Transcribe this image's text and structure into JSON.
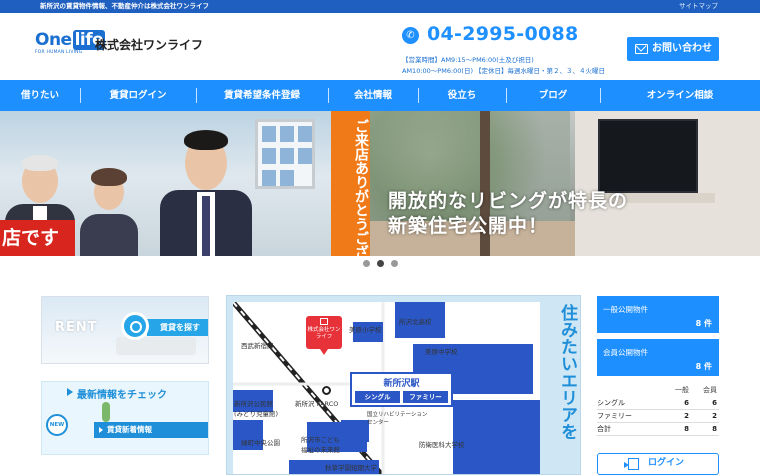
{
  "topbar": {
    "tagline": "新所沢の賃貸物件情報、不動産仲介は株式会社ワンライフ",
    "sitemap": "サイトマップ"
  },
  "header": {
    "logo_one": "One",
    "logo_life": "life",
    "logo_sub": "FOR HUMAN LIVING",
    "company": "株式会社ワンライフ",
    "phone": "04-2995-0088",
    "hours1": "【営業時間】AM9:15～PM6:00(土及び祝日)",
    "hours2": "AM10:00～PM6:00(日) 【定休日】毎週水曜日・第２、３、４火曜日",
    "contact": "お問い合わせ"
  },
  "nav": [
    {
      "label": "借りたい"
    },
    {
      "label": "賃貸ログイン"
    },
    {
      "label": "賃貸希望条件登録"
    },
    {
      "label": "会社情報"
    },
    {
      "label": "役立ち"
    },
    {
      "label": "ブログ"
    },
    {
      "label": "オンライン相談"
    }
  ],
  "hero": {
    "orange_text": "ご来店ありがとうございます☆",
    "red_text": "店です",
    "caption1": "開放的なリビングが特長の",
    "caption2": "新築住宅公開中！",
    "slides": 3,
    "active_slide": 2
  },
  "banners": {
    "rent_word": "RENT",
    "rent_search": "賃貸を探す",
    "news_title": "最新情報をチェック",
    "news_badge": "NEW",
    "news_bar": "賃貸新着情報"
  },
  "map": {
    "side_text": "住みたいエリアを",
    "pin": "株式会社ワンライフ",
    "station": "新所沢駅",
    "tag_single": "シングル",
    "tag_family": "ファミリー",
    "labels": [
      "所沢北高校",
      "美原小学校",
      "美原中学校",
      "西武新宿線",
      "新所沢公民館\n(みどり児童館)",
      "新所沢 PARCO",
      "国立リハビリテーション\nセンター",
      "所沢市こども\n福祉の未来館",
      "緑町中央公園",
      "防衛医科大学校",
      "秋草学園短期大学"
    ]
  },
  "stats": {
    "general_label": "一般公開物件",
    "general_count": "8 件",
    "member_label": "会員公開物件",
    "member_count": "8 件",
    "table_head": [
      "",
      "一般",
      "会員"
    ],
    "rows": [
      [
        "シングル",
        "6",
        "6"
      ],
      [
        "ファミリー",
        "2",
        "2"
      ],
      [
        "合計",
        "8",
        "8"
      ]
    ],
    "login": "ログイン"
  },
  "colors": {
    "nav_blue": "#1e8fff",
    "top_blue": "#1f5fbf",
    "map_blue": "#2b57c6",
    "orange": "#f07a18",
    "red": "#d8261f"
  }
}
